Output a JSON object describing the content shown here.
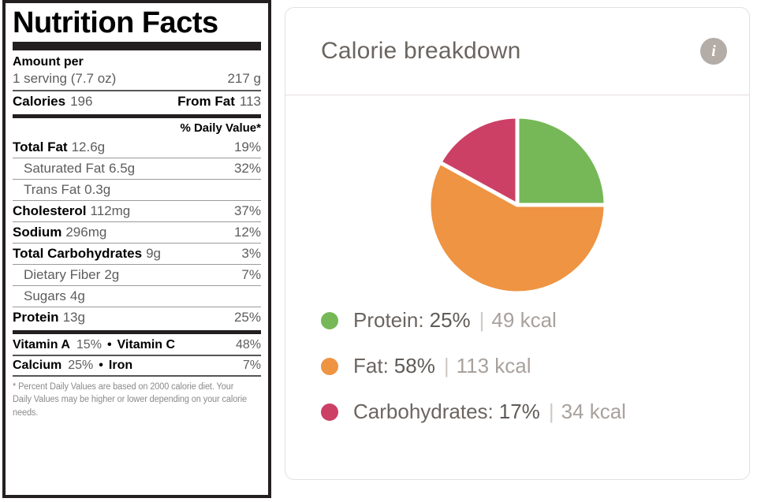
{
  "nutrition": {
    "title": "Nutrition Facts",
    "amount_per_label": "Amount per",
    "serving": "1 serving (7.7 oz)",
    "serving_weight": "217 g",
    "calories_label": "Calories",
    "calories_value": "196",
    "from_fat_label": "From Fat",
    "from_fat_value": "113",
    "daily_value_header": "% Daily Value*",
    "rows": [
      {
        "name": "Total Fat",
        "amount": "12.6g",
        "pct": "19%",
        "bold": true,
        "indent": false
      },
      {
        "name": "Saturated Fat",
        "amount": "6.5g",
        "pct": "32%",
        "bold": false,
        "indent": true
      },
      {
        "name": "Trans Fat",
        "amount": "0.3g",
        "pct": "",
        "bold": false,
        "indent": true
      },
      {
        "name": "Cholesterol",
        "amount": "112mg",
        "pct": "37%",
        "bold": true,
        "indent": false
      },
      {
        "name": "Sodium",
        "amount": "296mg",
        "pct": "12%",
        "bold": true,
        "indent": false
      },
      {
        "name": "Total Carbohydrates",
        "amount": "9g",
        "pct": "3%",
        "bold": true,
        "indent": false
      },
      {
        "name": "Dietary Fiber",
        "amount": "2g",
        "pct": "7%",
        "bold": false,
        "indent": true
      },
      {
        "name": "Sugars",
        "amount": "4g",
        "pct": "",
        "bold": false,
        "indent": true
      },
      {
        "name": "Protein",
        "amount": "13g",
        "pct": "25%",
        "bold": true,
        "indent": false
      }
    ],
    "micronutrients": [
      {
        "left_name": "Vitamin A",
        "left_value": "15%",
        "separator": "•",
        "right_name": "Vitamin C",
        "right_value": "48%"
      },
      {
        "left_name": "Calcium",
        "left_value": "25%",
        "separator": "•",
        "right_name": "Iron",
        "right_value": "7%"
      }
    ],
    "footnote": "* Percent Daily Values are based on 2000 calorie diet. Your Daily Values may be higher or lower depending on your calorie needs."
  },
  "calorie_card": {
    "title": "Calorie breakdown",
    "info_icon": "info-icon",
    "info_glyph": "i"
  },
  "chart_data": {
    "type": "pie",
    "title": "Calorie breakdown",
    "unit": "kcal",
    "total_kcal": 196,
    "start_angle": 0,
    "direction": "clockwise",
    "legend_position": "bottom-left",
    "slice_gap_color": "#ffffff",
    "categories": [
      "Protein",
      "Fat",
      "Carbohydrates"
    ],
    "values": [
      25,
      58,
      17
    ],
    "kcal_values": [
      49,
      113,
      34
    ],
    "colors": [
      "#76b857",
      "#ee9442",
      "#cc4065"
    ],
    "slices": [
      {
        "label": "Protein",
        "percent": 25,
        "percent_text": "25%",
        "kcal": 49,
        "kcal_text": "49 kcal",
        "color": "#76b857"
      },
      {
        "label": "Fat",
        "percent": 58,
        "percent_text": "58%",
        "kcal": 113,
        "kcal_text": "113 kcal",
        "color": "#ee9442"
      },
      {
        "label": "Carbohydrates",
        "percent": 17,
        "percent_text": "17%",
        "kcal": 34,
        "kcal_text": "34 kcal",
        "color": "#cc4065"
      }
    ]
  }
}
